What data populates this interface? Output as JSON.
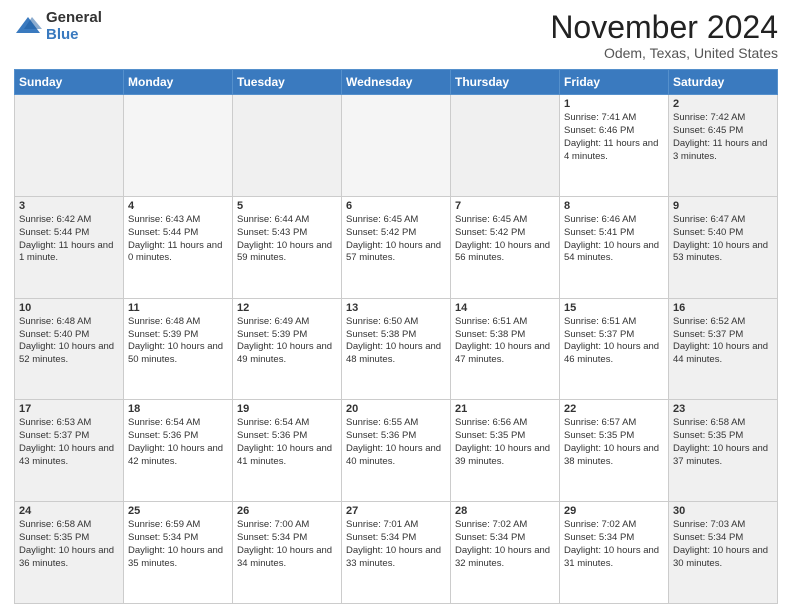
{
  "header": {
    "logo_general": "General",
    "logo_blue": "Blue",
    "month": "November 2024",
    "location": "Odem, Texas, United States"
  },
  "weekdays": [
    "Sunday",
    "Monday",
    "Tuesday",
    "Wednesday",
    "Thursday",
    "Friday",
    "Saturday"
  ],
  "weeks": [
    [
      {
        "day": "",
        "empty": true
      },
      {
        "day": "",
        "empty": true
      },
      {
        "day": "",
        "empty": true
      },
      {
        "day": "",
        "empty": true
      },
      {
        "day": "",
        "empty": true
      },
      {
        "day": "1",
        "sunrise": "7:41 AM",
        "sunset": "6:46 PM",
        "daylight": "11 hours and 4 minutes."
      },
      {
        "day": "2",
        "sunrise": "7:42 AM",
        "sunset": "6:45 PM",
        "daylight": "11 hours and 3 minutes."
      }
    ],
    [
      {
        "day": "3",
        "sunrise": "6:42 AM",
        "sunset": "5:44 PM",
        "daylight": "11 hours and 1 minute."
      },
      {
        "day": "4",
        "sunrise": "6:43 AM",
        "sunset": "5:44 PM",
        "daylight": "11 hours and 0 minutes."
      },
      {
        "day": "5",
        "sunrise": "6:44 AM",
        "sunset": "5:43 PM",
        "daylight": "10 hours and 59 minutes."
      },
      {
        "day": "6",
        "sunrise": "6:45 AM",
        "sunset": "5:42 PM",
        "daylight": "10 hours and 57 minutes."
      },
      {
        "day": "7",
        "sunrise": "6:45 AM",
        "sunset": "5:42 PM",
        "daylight": "10 hours and 56 minutes."
      },
      {
        "day": "8",
        "sunrise": "6:46 AM",
        "sunset": "5:41 PM",
        "daylight": "10 hours and 54 minutes."
      },
      {
        "day": "9",
        "sunrise": "6:47 AM",
        "sunset": "5:40 PM",
        "daylight": "10 hours and 53 minutes."
      }
    ],
    [
      {
        "day": "10",
        "sunrise": "6:48 AM",
        "sunset": "5:40 PM",
        "daylight": "10 hours and 52 minutes."
      },
      {
        "day": "11",
        "sunrise": "6:48 AM",
        "sunset": "5:39 PM",
        "daylight": "10 hours and 50 minutes."
      },
      {
        "day": "12",
        "sunrise": "6:49 AM",
        "sunset": "5:39 PM",
        "daylight": "10 hours and 49 minutes."
      },
      {
        "day": "13",
        "sunrise": "6:50 AM",
        "sunset": "5:38 PM",
        "daylight": "10 hours and 48 minutes."
      },
      {
        "day": "14",
        "sunrise": "6:51 AM",
        "sunset": "5:38 PM",
        "daylight": "10 hours and 47 minutes."
      },
      {
        "day": "15",
        "sunrise": "6:51 AM",
        "sunset": "5:37 PM",
        "daylight": "10 hours and 46 minutes."
      },
      {
        "day": "16",
        "sunrise": "6:52 AM",
        "sunset": "5:37 PM",
        "daylight": "10 hours and 44 minutes."
      }
    ],
    [
      {
        "day": "17",
        "sunrise": "6:53 AM",
        "sunset": "5:37 PM",
        "daylight": "10 hours and 43 minutes."
      },
      {
        "day": "18",
        "sunrise": "6:54 AM",
        "sunset": "5:36 PM",
        "daylight": "10 hours and 42 minutes."
      },
      {
        "day": "19",
        "sunrise": "6:54 AM",
        "sunset": "5:36 PM",
        "daylight": "10 hours and 41 minutes."
      },
      {
        "day": "20",
        "sunrise": "6:55 AM",
        "sunset": "5:36 PM",
        "daylight": "10 hours and 40 minutes."
      },
      {
        "day": "21",
        "sunrise": "6:56 AM",
        "sunset": "5:35 PM",
        "daylight": "10 hours and 39 minutes."
      },
      {
        "day": "22",
        "sunrise": "6:57 AM",
        "sunset": "5:35 PM",
        "daylight": "10 hours and 38 minutes."
      },
      {
        "day": "23",
        "sunrise": "6:58 AM",
        "sunset": "5:35 PM",
        "daylight": "10 hours and 37 minutes."
      }
    ],
    [
      {
        "day": "24",
        "sunrise": "6:58 AM",
        "sunset": "5:35 PM",
        "daylight": "10 hours and 36 minutes."
      },
      {
        "day": "25",
        "sunrise": "6:59 AM",
        "sunset": "5:34 PM",
        "daylight": "10 hours and 35 minutes."
      },
      {
        "day": "26",
        "sunrise": "7:00 AM",
        "sunset": "5:34 PM",
        "daylight": "10 hours and 34 minutes."
      },
      {
        "day": "27",
        "sunrise": "7:01 AM",
        "sunset": "5:34 PM",
        "daylight": "10 hours and 33 minutes."
      },
      {
        "day": "28",
        "sunrise": "7:02 AM",
        "sunset": "5:34 PM",
        "daylight": "10 hours and 32 minutes."
      },
      {
        "day": "29",
        "sunrise": "7:02 AM",
        "sunset": "5:34 PM",
        "daylight": "10 hours and 31 minutes."
      },
      {
        "day": "30",
        "sunrise": "7:03 AM",
        "sunset": "5:34 PM",
        "daylight": "10 hours and 30 minutes."
      }
    ]
  ]
}
